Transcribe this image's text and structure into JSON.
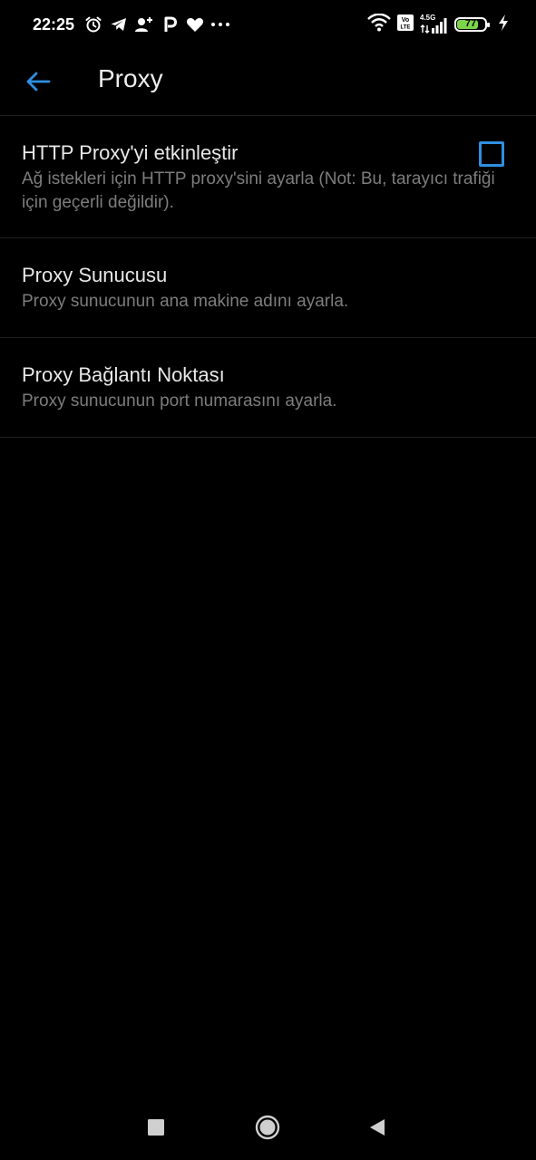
{
  "status_bar": {
    "time": "22:25",
    "network_type": "4.5G",
    "volte_label": "Vo LTE",
    "battery_level": "77",
    "battery_fraction": 0.77,
    "left_icons": [
      "alarm-icon",
      "telegram-icon",
      "add-person-icon",
      "p-app-icon",
      "heart-icon",
      "more-notifications-icon"
    ],
    "right_icons": [
      "wifi-icon",
      "volte-icon",
      "signal-icon",
      "battery-icon",
      "charging-icon"
    ]
  },
  "app_bar": {
    "title": "Proxy",
    "back_icon": "arrow-back-icon",
    "accent_color": "#2f8fe0"
  },
  "settings": [
    {
      "title": "HTTP Proxy'yi etkinleştir",
      "description": "Ağ istekleri için HTTP proxy'sini ayarla (Not: Bu, tarayıcı trafiği için geçerli değildir).",
      "has_checkbox": true,
      "checked": false
    },
    {
      "title": "Proxy Sunucusu",
      "description": "Proxy sunucunun ana makine adını ayarla."
    },
    {
      "title": "Proxy Bağlantı Noktası",
      "description": "Proxy sunucunun port numarasını ayarla."
    }
  ],
  "nav_bar": {
    "buttons": [
      "recents-square-icon",
      "home-circle-icon",
      "back-triangle-icon"
    ]
  }
}
